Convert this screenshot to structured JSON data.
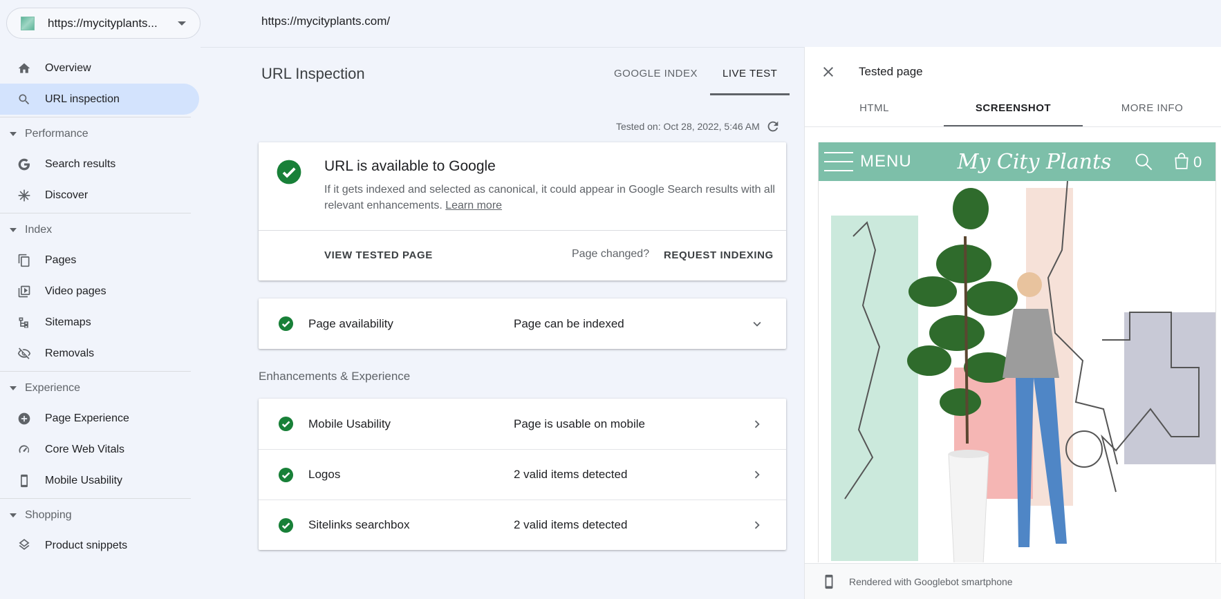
{
  "sidebar": {
    "property": "https://mycityplants...",
    "items": [
      {
        "id": "overview",
        "label": "Overview",
        "icon": "home-icon"
      },
      {
        "id": "url-inspection",
        "label": "URL inspection",
        "icon": "search-icon",
        "active": true
      }
    ],
    "sections": [
      {
        "title": "Performance",
        "items": [
          {
            "id": "search-results",
            "label": "Search results",
            "icon": "google-g-icon"
          },
          {
            "id": "discover",
            "label": "Discover",
            "icon": "asterisk-icon"
          }
        ]
      },
      {
        "title": "Index",
        "items": [
          {
            "id": "pages",
            "label": "Pages",
            "icon": "pages-icon"
          },
          {
            "id": "video-pages",
            "label": "Video pages",
            "icon": "video-pages-icon"
          },
          {
            "id": "sitemaps",
            "label": "Sitemaps",
            "icon": "sitemap-icon"
          },
          {
            "id": "removals",
            "label": "Removals",
            "icon": "eye-off-icon"
          }
        ]
      },
      {
        "title": "Experience",
        "items": [
          {
            "id": "page-experience",
            "label": "Page Experience",
            "icon": "plus-circle-icon"
          },
          {
            "id": "core-web-vitals",
            "label": "Core Web Vitals",
            "icon": "gauge-icon"
          },
          {
            "id": "mobile-usability",
            "label": "Mobile Usability",
            "icon": "smartphone-icon"
          }
        ]
      },
      {
        "title": "Shopping",
        "items": [
          {
            "id": "product-snippets",
            "label": "Product snippets",
            "icon": "layers-icon"
          }
        ]
      }
    ]
  },
  "header": {
    "url": "https://mycityplants.com/"
  },
  "main": {
    "title": "URL Inspection",
    "tabs": [
      {
        "label": "GOOGLE INDEX"
      },
      {
        "label": "LIVE TEST",
        "active": true
      }
    ],
    "tested_on": "Tested on: Oct 28, 2022, 5:46 AM",
    "availability": {
      "headline": "URL is available to Google",
      "description": "If it gets indexed and selected as canonical, it could appear in Google Search results with all relevant enhancements.",
      "learn_more": "Learn more",
      "view_button": "VIEW TESTED PAGE",
      "changed": "Page changed?",
      "request_button": "REQUEST INDEXING"
    },
    "page_availability": {
      "label": "Page availability",
      "value": "Page can be indexed"
    },
    "enhancements_title": "Enhancements & Experience",
    "enhancements": [
      {
        "label": "Mobile Usability",
        "value": "Page is usable on mobile"
      },
      {
        "label": "Logos",
        "value": "2 valid items detected"
      },
      {
        "label": "Sitelinks searchbox",
        "value": "2 valid items detected"
      }
    ]
  },
  "panel": {
    "title": "Tested page",
    "tabs": [
      {
        "label": "HTML"
      },
      {
        "label": "SCREENSHOT",
        "active": true
      },
      {
        "label": "MORE INFO"
      }
    ],
    "screenshot": {
      "menu": "MENU",
      "logo": "My City Plants",
      "cart_count": "0"
    },
    "footer": "Rendered with Googlebot smartphone"
  },
  "colors": {
    "check_green": "#188038",
    "accent_teal": "#7dbfa9",
    "active_nav": "#d3e3fd"
  }
}
